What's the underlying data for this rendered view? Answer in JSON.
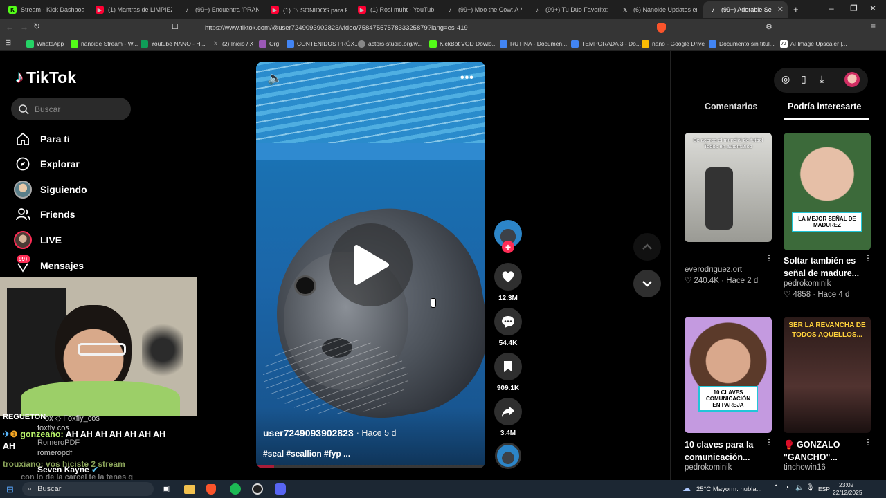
{
  "browser": {
    "tabs": [
      {
        "title": "Stream - Kick Dashboard",
        "icon": "kick-icon",
        "color": "#53fc18"
      },
      {
        "title": "(1) Mantras de LIMPIEZA E",
        "icon": "youtube-icon",
        "color": "#ff0033"
      },
      {
        "title": "(99+) Encuentra 'PRANK FA",
        "icon": "tiktok-icon",
        "color": "#ffffff"
      },
      {
        "title": "(1) 〽 SONIDOS para PER",
        "icon": "youtube-icon",
        "color": "#ff0033"
      },
      {
        "title": "(1) Rosi muht - YouTube",
        "icon": "youtube-icon",
        "color": "#ff0033"
      },
      {
        "title": "(99+) Moo the Cow: A Mo",
        "icon": "tiktok-icon",
        "color": "#ffffff"
      },
      {
        "title": "(99+) Tu Dúo Favorito: Me",
        "icon": "tiktok-icon",
        "color": "#ffffff"
      },
      {
        "title": "(6) Nanoide Updates en X",
        "icon": "x-icon",
        "color": "#ffffff"
      },
      {
        "title": "(99+) Adorable Se",
        "icon": "tiktok-icon",
        "color": "#ffffff",
        "active": true
      }
    ],
    "url": "https://www.tiktok.com/@user7249093902823/video/7584755757833325879?lang=es-419",
    "bookmarks": [
      {
        "label": "WhatsApp",
        "color": "#25d366"
      },
      {
        "label": "nanoide Stream - W...",
        "color": "#53fc18"
      },
      {
        "label": "Youtube NANO - H...",
        "color": "#0f9d58"
      },
      {
        "label": "(2) Inicio / X",
        "color": "#ffffff"
      },
      {
        "label": "Org",
        "color": "#9b59b6"
      },
      {
        "label": "CONTENIDOS PRÓX...",
        "color": "#4285f4"
      },
      {
        "label": "actors-studio.org/w...",
        "color": "#cccccc"
      },
      {
        "label": "KickBot VOD Dowlo...",
        "color": "#53fc18"
      },
      {
        "label": "RUTINA - Documen...",
        "color": "#4285f4"
      },
      {
        "label": "TEMPORADA 3 - Do...",
        "color": "#4285f4"
      },
      {
        "label": "nano - Google Drive",
        "color": "#fbbc04"
      },
      {
        "label": "Documento sin títul...",
        "color": "#4285f4"
      },
      {
        "label": "AI Image Upscaler |...",
        "color": "#ffffff"
      }
    ]
  },
  "tiktok": {
    "logo": "TikTok",
    "search_placeholder": "Buscar",
    "nav": [
      {
        "label": "Para ti",
        "icon": "home-icon"
      },
      {
        "label": "Explorar",
        "icon": "compass-icon"
      },
      {
        "label": "Siguiendo",
        "icon": "following-avatar-icon"
      },
      {
        "label": "Friends",
        "icon": "friends-icon"
      },
      {
        "label": "LIVE",
        "icon": "live-avatar-icon"
      },
      {
        "label": "Mensajes",
        "icon": "messages-icon",
        "badge": "99+"
      }
    ],
    "video": {
      "author": "user7249093902823",
      "age": "· Hace 5 d",
      "tags": "#seal #seallion #fyp ..."
    },
    "actions": {
      "likes": "12.3M",
      "comments": "54.4K",
      "saves": "909.1K",
      "shares": "3.4M"
    },
    "panel_tabs": [
      "Comentarios",
      "Podría interesarte"
    ],
    "cards": [
      {
        "thumb_text": "Se acerca el mundial de futbol Todos en automático",
        "title": "",
        "author": "everodriguez.ort",
        "likes": "240.4K",
        "age": "Hace 2 d"
      },
      {
        "thumb_text": "LA MEJOR SEÑAL DE MADUREZ",
        "title": "Soltar también es señal de madure...",
        "author": "pedrokominik",
        "likes": "4858",
        "age": "Hace 4 d"
      },
      {
        "thumb_text": "10 CLAVES COMUNICACIÓN EN PAREJA",
        "title": "10 claves para la comunicación...",
        "author": "pedrokominik",
        "likes": "",
        "age": ""
      },
      {
        "thumb_text": "SER LA REVANCHA DE TODOS AQUELLOS...",
        "title": "🥊 GONZALO \"GANCHO\"...",
        "author": "tinchowin16",
        "likes": "",
        "age": ""
      }
    ]
  },
  "stream_chat": {
    "lines": [
      {
        "user": "REGUETON",
        "text": "",
        "color": "#ffffff"
      },
      {
        "user": "Foxfly_cos",
        "text": "fox ◇",
        "color": "#bbbbbb"
      },
      {
        "user": "foxfly cos",
        "text": "",
        "color": "#bbbbbb"
      },
      {
        "user": "gonzeano:",
        "text": "AH AH AH AH AH AH AH AH",
        "color": "#b9f56a"
      },
      {
        "user": "RomeroPDF",
        "text": "",
        "color": "#bbbbbb"
      },
      {
        "user": "romeropdf",
        "text": "",
        "color": "#bbbbbb"
      },
      {
        "user": "trouxiano:",
        "text": "vos hiciste 2 stream",
        "color": "#b9f56a"
      },
      {
        "user": "Seven Kayne",
        "text": "con lo de la carcel te la tenes q",
        "color": "#ffffff"
      }
    ]
  },
  "taskbar": {
    "search": "Buscar",
    "weather": "25°C  Mayorm. nubla...",
    "lang": "ESP",
    "time": "23:02",
    "date": "22/12/2025"
  }
}
